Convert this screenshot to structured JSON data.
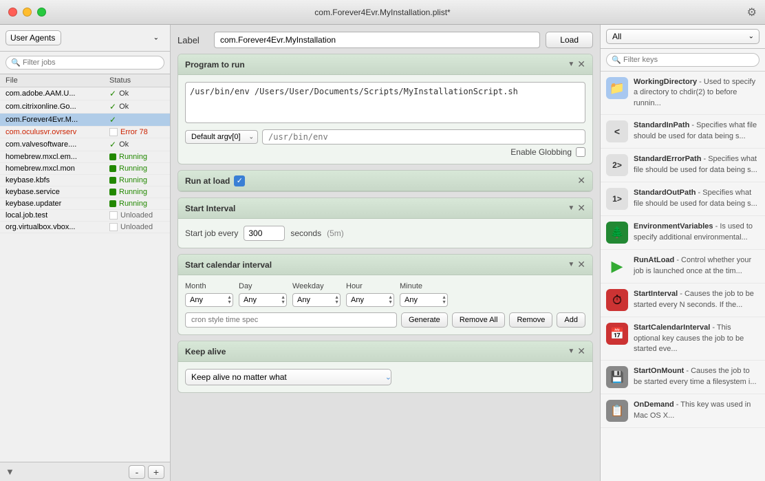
{
  "window": {
    "title": "com.Forever4Evr.MyInstallation.plist*"
  },
  "sidebar": {
    "agent_selector": "User Agents",
    "filter_placeholder": "Filter jobs",
    "col_file": "File",
    "col_status": "Status",
    "files": [
      {
        "name": "com.adobe.AAM.U...",
        "status": "Ok",
        "statusType": "ok",
        "hasCheck": true
      },
      {
        "name": "com.citrixonline.Go...",
        "status": "Ok",
        "statusType": "ok",
        "hasCheck": true
      },
      {
        "name": "com.Forever4Evr.M...",
        "status": "",
        "statusType": "selected",
        "hasCheck": true
      },
      {
        "name": "com.oculusvr.ovrserv",
        "status": "Error 78",
        "statusType": "error",
        "hasCheck": false
      },
      {
        "name": "com.valvesoftware....",
        "status": "Ok",
        "statusType": "ok",
        "hasCheck": true
      },
      {
        "name": "homebrew.mxcl.em...",
        "status": "Running",
        "statusType": "running",
        "hasCheck": true
      },
      {
        "name": "homebrew.mxcl.mon",
        "status": "Running",
        "statusType": "running",
        "hasCheck": true
      },
      {
        "name": "keybase.kbfs",
        "status": "Running",
        "statusType": "running",
        "hasCheck": true
      },
      {
        "name": "keybase.service",
        "status": "Running",
        "statusType": "running",
        "hasCheck": true
      },
      {
        "name": "keybase.updater",
        "status": "Running",
        "statusType": "running",
        "hasCheck": true
      },
      {
        "name": "local.job.test",
        "status": "Unloaded",
        "statusType": "unloaded",
        "hasCheck": false
      },
      {
        "name": "org.virtualbox.vbox...",
        "status": "Unloaded",
        "statusType": "unloaded",
        "hasCheck": false
      }
    ],
    "add_label": "+",
    "remove_label": "-"
  },
  "center": {
    "label_text": "Label",
    "label_value": "com.Forever4Evr.MyInstallation",
    "load_button": "Load",
    "program_section": {
      "title": "Program to run",
      "program_value": "/usr/bin/env /Users/User/Documents/Scripts/MyInstallationScript.sh",
      "argv_default": "Default argv[0]",
      "argv_placeholder": "/usr/bin/env",
      "globbing_label": "Enable Globbing"
    },
    "run_at_load": {
      "title": "Run at load",
      "checked": true
    },
    "start_interval": {
      "title": "Start Interval",
      "label": "Start job every",
      "value": "300",
      "unit": "seconds",
      "detail": "(5m)"
    },
    "calendar_interval": {
      "title": "Start calendar interval",
      "columns": [
        "Month",
        "Day",
        "Weekday",
        "Hour",
        "Minute"
      ],
      "values": [
        "Any",
        "Any",
        "Any",
        "Any",
        "Any"
      ],
      "cron_placeholder": "cron style time spec",
      "generate_btn": "Generate",
      "remove_all_btn": "Remove All",
      "remove_btn": "Remove",
      "add_btn": "Add"
    },
    "keep_alive": {
      "title": "Keep alive",
      "option": "Keep alive no matter what"
    }
  },
  "right_panel": {
    "filter_label": "All",
    "filter_placeholder": "Filter keys",
    "keys": [
      {
        "icon_type": "folder",
        "name": "WorkingDirectory",
        "desc": "- Used to specify a directory to chdir(2) to before runnin..."
      },
      {
        "icon_type": "stdin",
        "icon_text": "<",
        "name": "StandardInPath",
        "desc": "- Specifies what file should be used for data being s..."
      },
      {
        "icon_type": "stderr",
        "icon_text": "2>",
        "name": "StandardErrorPath",
        "desc": "- Specifies what file should be used for data being s..."
      },
      {
        "icon_type": "stdout",
        "icon_text": "1>",
        "name": "StandardOutPath",
        "desc": "- Specifies what file should be used for data being s..."
      },
      {
        "icon_type": "env",
        "icon_text": "🌲",
        "name": "EnvironmentVariables",
        "desc": "- Is used to specify additional environmental..."
      },
      {
        "icon_type": "run",
        "icon_text": "▶",
        "name": "RunAtLoad",
        "desc": "- Control whether your job is launched once at the tim..."
      },
      {
        "icon_type": "interval",
        "icon_text": "⏱",
        "name": "StartInterval",
        "desc": "- Causes the job to be started every N seconds.  If the..."
      },
      {
        "icon_type": "cal",
        "icon_text": "📅",
        "name": "StartCalendarInterval",
        "desc": "- This optional key causes the job to be started eve..."
      },
      {
        "icon_type": "mount",
        "icon_text": "💾",
        "name": "StartOnMount",
        "desc": "- Causes the job to be started every time a filesystem i..."
      },
      {
        "icon_type": "demand",
        "icon_text": "📋",
        "name": "OnDemand",
        "desc": "- This key was used in Mac OS X..."
      }
    ]
  }
}
